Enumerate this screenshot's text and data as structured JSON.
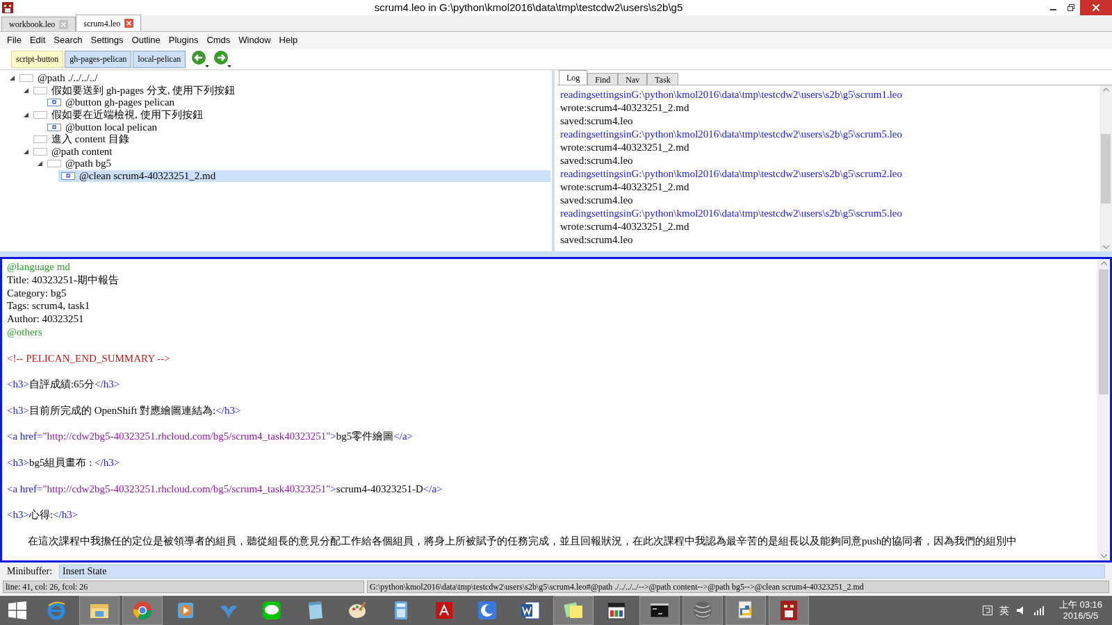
{
  "window": {
    "title": "scrum4.leo in G:\\python\\kmol2016\\data\\tmp\\testcdw2\\users\\s2b\\g5"
  },
  "file_tabs": [
    {
      "label": "workbook.leo",
      "selected": false
    },
    {
      "label": "scrum4.leo",
      "selected": true
    }
  ],
  "menu": [
    "File",
    "Edit",
    "Search",
    "Settings",
    "Outline",
    "Plugins",
    "Cmds",
    "Window",
    "Help"
  ],
  "toolbar": {
    "buttons": [
      {
        "label": "script-button",
        "kind": "script"
      },
      {
        "label": "gh-pages-pelican",
        "kind": "user"
      },
      {
        "label": "local-pelican",
        "kind": "user"
      }
    ]
  },
  "outline": [
    {
      "label": "@path ./../../../",
      "kind": "plain",
      "expanded": true,
      "selected": false,
      "children": [
        {
          "label": "假如要送到 gh-pages 分支, 使用下列按鈕",
          "kind": "plain",
          "expanded": true,
          "selected": false,
          "children": [
            {
              "label": "@button gh-pages pelican",
              "kind": "body",
              "selected": false
            }
          ]
        },
        {
          "label": "假如要在近端檢視, 使用下列按鈕",
          "kind": "plain",
          "expanded": true,
          "selected": false,
          "children": [
            {
              "label": "@button local pelican",
              "kind": "body",
              "selected": false
            }
          ]
        },
        {
          "label": "進入 content 目錄",
          "kind": "plain",
          "selected": false
        },
        {
          "label": "@path content",
          "kind": "plain",
          "expanded": true,
          "selected": false,
          "children": [
            {
              "label": "@path bg5",
              "kind": "plain",
              "expanded": true,
              "selected": false,
              "children": [
                {
                  "label": "@clean scrum4-40323251_2.md",
                  "kind": "body",
                  "selected": true
                }
              ]
            }
          ]
        }
      ]
    }
  ],
  "log_tabs": [
    {
      "label": "Log",
      "selected": true
    },
    {
      "label": "Find",
      "selected": false
    },
    {
      "label": "Nav",
      "selected": false
    },
    {
      "label": "Task",
      "selected": false
    }
  ],
  "log": [
    {
      "text": "readingsettingsinG:\\python\\kmol2016\\data\\tmp\\testcdw2\\users\\s2b\\g5\\scrum1.leo",
      "kind": "info"
    },
    {
      "text": "wrote:scrum4-40323251_2.md",
      "kind": "plain"
    },
    {
      "text": "saved:scrum4.leo",
      "kind": "plain"
    },
    {
      "text": "readingsettingsinG:\\python\\kmol2016\\data\\tmp\\testcdw2\\users\\s2b\\g5\\scrum5.leo",
      "kind": "info"
    },
    {
      "text": "wrote:scrum4-40323251_2.md",
      "kind": "plain"
    },
    {
      "text": "saved:scrum4.leo",
      "kind": "plain"
    },
    {
      "text": "readingsettingsinG:\\python\\kmol2016\\data\\tmp\\testcdw2\\users\\s2b\\g5\\scrum2.leo",
      "kind": "info"
    },
    {
      "text": "wrote:scrum4-40323251_2.md",
      "kind": "plain"
    },
    {
      "text": "saved:scrum4.leo",
      "kind": "plain"
    },
    {
      "text": "readingsettingsinG:\\python\\kmol2016\\data\\tmp\\testcdw2\\users\\s2b\\g5\\scrum5.leo",
      "kind": "info"
    },
    {
      "text": "wrote:scrum4-40323251_2.md",
      "kind": "plain"
    },
    {
      "text": "saved:scrum4.leo",
      "kind": "plain"
    }
  ],
  "body": [
    {
      "lines": [
        {
          "segments": [
            {
              "text": "@language md",
              "kind": "directive"
            }
          ]
        },
        {
          "segments": [
            {
              "text": "Title: 40323251-期中報告",
              "kind": "text"
            }
          ]
        },
        {
          "segments": [
            {
              "text": "Category: bg5",
              "kind": "text"
            }
          ]
        },
        {
          "segments": [
            {
              "text": "Tags: scrum4, task1",
              "kind": "text"
            }
          ]
        },
        {
          "segments": [
            {
              "text": "Author: 40323251",
              "kind": "text"
            }
          ]
        },
        {
          "segments": [
            {
              "text": "@others",
              "kind": "directive"
            }
          ]
        }
      ]
    },
    {
      "lines": [
        {
          "segments": [
            {
              "text": "<!-- PELICAN_END_SUMMARY -->",
              "kind": "comment"
            }
          ]
        }
      ]
    },
    {
      "lines": [
        {
          "segments": [
            {
              "text": "<h3>",
              "kind": "tag"
            },
            {
              "text": "自評成績:65分",
              "kind": "text"
            },
            {
              "text": "</h3>",
              "kind": "tag"
            }
          ]
        }
      ]
    },
    {
      "lines": [
        {
          "segments": [
            {
              "text": "<h3>",
              "kind": "tag"
            },
            {
              "text": "目前所完成的 OpenShift 對應繪圖連結為:",
              "kind": "text"
            },
            {
              "text": "</h3>",
              "kind": "tag"
            }
          ]
        }
      ]
    },
    {
      "lines": [
        {
          "segments": [
            {
              "text": "<a href=",
              "kind": "tag"
            },
            {
              "text": "\"http://cdw2bg5-40323251.rhcloud.com/bg5/scrum4_task40323251\"",
              "kind": "string"
            },
            {
              "text": ">",
              "kind": "tag"
            },
            {
              "text": "bg5零件繪圖",
              "kind": "text"
            },
            {
              "text": "</a>",
              "kind": "tag"
            }
          ]
        }
      ]
    },
    {
      "lines": [
        {
          "segments": [
            {
              "text": "<h3>",
              "kind": "tag"
            },
            {
              "text": "bg5組員畫布 : ",
              "kind": "text"
            },
            {
              "text": "</h3>",
              "kind": "tag"
            }
          ]
        }
      ]
    },
    {
      "lines": [
        {
          "segments": [
            {
              "text": "<a href=",
              "kind": "tag"
            },
            {
              "text": "\"http://cdw2bg5-40323251.rhcloud.com/bg5/scrum4_task40323251\"",
              "kind": "string"
            },
            {
              "text": ">",
              "kind": "tag"
            },
            {
              "text": "scrum4-40323251-D",
              "kind": "text"
            },
            {
              "text": "</a>",
              "kind": "tag"
            }
          ]
        }
      ]
    },
    {
      "lines": [
        {
          "segments": [
            {
              "text": "<h3>",
              "kind": "tag"
            },
            {
              "text": "心得:",
              "kind": "text"
            },
            {
              "text": "</h3>",
              "kind": "tag"
            }
          ]
        }
      ]
    },
    {
      "lines": [
        {
          "segments": [
            {
              "text": "　　在這次課程中我擔任的定位是被領導者的組員，聽從組長的意見分配工作給各個組員，將身上所被賦予的任務完成，並且回報狀況，在此次課程中我認為最辛苦的是組長以及能夠同意push的協同者，因為我們的組別中",
              "kind": "text"
            }
          ]
        }
      ]
    }
  ],
  "minibuffer": {
    "label": "Minibuffer:",
    "value": "Insert State"
  },
  "status_bar": {
    "position": "line: 41, col: 26, fcol: 26",
    "path": "G:\\python\\kmol2016\\data\\tmp\\testcdw2\\users\\s2b\\g5\\scrum4.leo#@path ./../../../-->@path content-->@path bg5-->@clean scrum4-40323251_2.md"
  },
  "taskbar": {
    "apps": [
      {
        "kind": "browser-e",
        "running": false
      },
      {
        "kind": "folder",
        "running": true
      },
      {
        "kind": "browser-ring",
        "running": true
      },
      {
        "kind": "player",
        "running": false
      },
      {
        "kind": "bird",
        "running": false
      },
      {
        "kind": "chat",
        "running": false
      },
      {
        "kind": "notepad",
        "running": false
      },
      {
        "kind": "paint",
        "running": false
      },
      {
        "kind": "calculator",
        "running": false
      },
      {
        "kind": "pdf",
        "running": false
      },
      {
        "kind": "crescent",
        "running": false
      },
      {
        "kind": "word",
        "running": false
      },
      {
        "kind": "notes",
        "running": true
      },
      {
        "kind": "clapper",
        "running": false
      },
      {
        "kind": "terminal",
        "running": true
      },
      {
        "kind": "sphere",
        "running": true
      },
      {
        "kind": "python",
        "running": true
      },
      {
        "kind": "leo",
        "running": true
      }
    ],
    "ime": "英",
    "time": "上午 03:16",
    "date": "2016/5/5"
  }
}
